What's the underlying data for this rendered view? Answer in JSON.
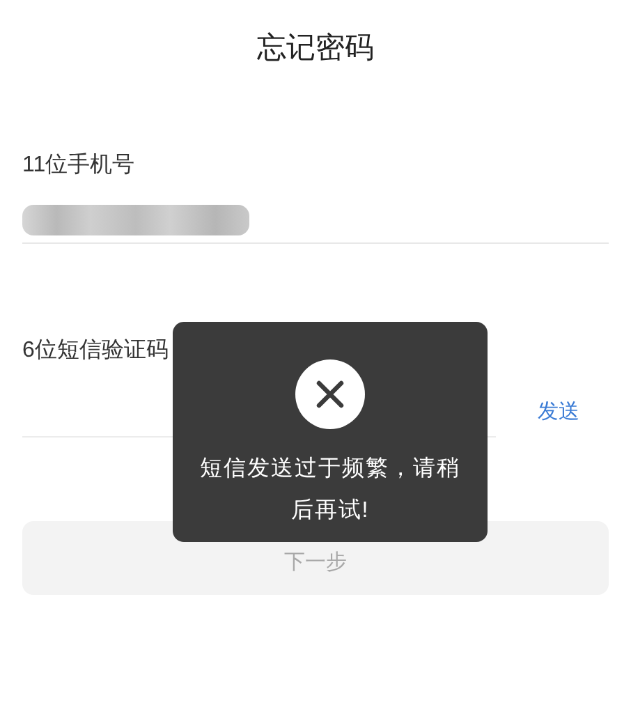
{
  "title": "忘记密码",
  "phone_field": {
    "label": "11位手机号",
    "masked": true
  },
  "code_field": {
    "label": "6位短信验证码",
    "send_button": "发送"
  },
  "next_button": {
    "label": "下一步",
    "disabled": true
  },
  "toast": {
    "kind": "error",
    "message": "短信发送过于频繁，请稍后再试!"
  }
}
